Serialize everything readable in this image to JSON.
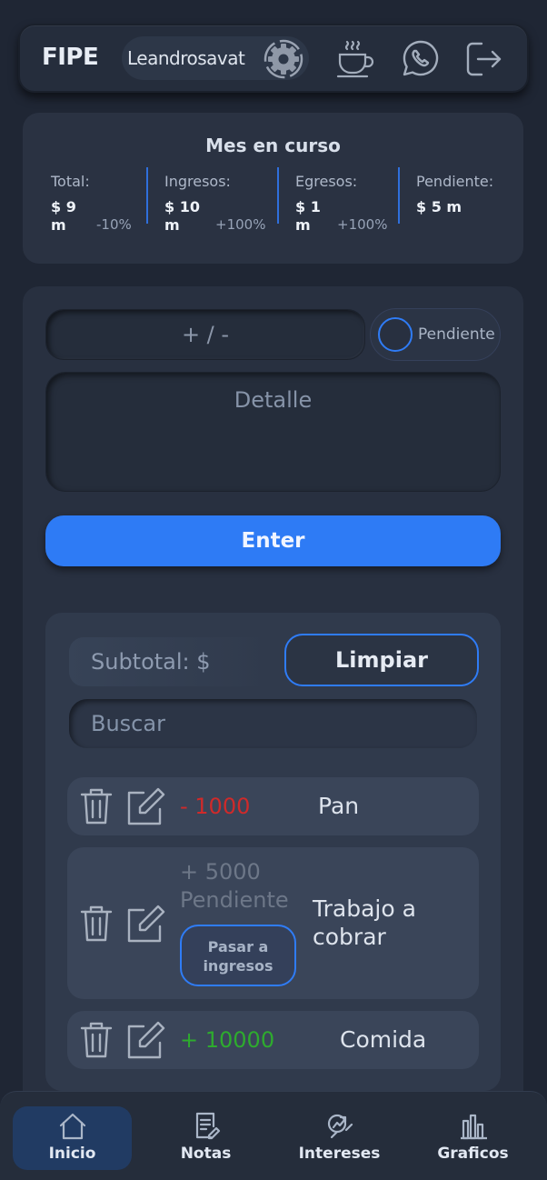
{
  "header": {
    "logo": "FIPE",
    "username": "Leandrosavat",
    "icons": [
      "gear-icon",
      "coffee-icon",
      "whatsapp-icon",
      "logout-icon"
    ]
  },
  "summary": {
    "title": "Mes en curso",
    "stats": [
      {
        "label": "Total:",
        "value": "$ 9 m",
        "pct": "-10%"
      },
      {
        "label": "Ingresos:",
        "value": "$ 10 m",
        "pct": "+100%"
      },
      {
        "label": "Egresos:",
        "value": "$ 1 m",
        "pct": "+100%"
      },
      {
        "label": "Pendiente:",
        "value": "$ 5 m",
        "pct": ""
      }
    ]
  },
  "form": {
    "amount_placeholder": "+ / -",
    "pending_label": "Pendiente",
    "detail_placeholder": "Detalle",
    "enter_label": "Enter"
  },
  "list": {
    "subtotal_label": "Subtotal: $",
    "clear_label": "Limpiar",
    "search_placeholder": "Buscar",
    "items": [
      {
        "amount": "- 1000",
        "kind": "expense",
        "description": "Pan"
      },
      {
        "amount": "+ 5000",
        "status": "Pendiente",
        "kind": "pending",
        "description": "Trabajo a cobrar",
        "action": "Pasar a ingresos"
      },
      {
        "amount": "+ 10000",
        "kind": "income",
        "description": "Comida"
      }
    ]
  },
  "nav": {
    "items": [
      {
        "label": "Inicio",
        "icon": "home-icon",
        "active": true
      },
      {
        "label": "Notas",
        "icon": "notes-icon",
        "active": false
      },
      {
        "label": "Intereses",
        "icon": "interest-icon",
        "active": false
      },
      {
        "label": "Graficos",
        "icon": "chart-icon",
        "active": false
      }
    ]
  },
  "colors": {
    "accent": "#2e7bf5",
    "negative": "#cf2a2a",
    "positive": "#2eab2e",
    "background": "#1f2634"
  }
}
